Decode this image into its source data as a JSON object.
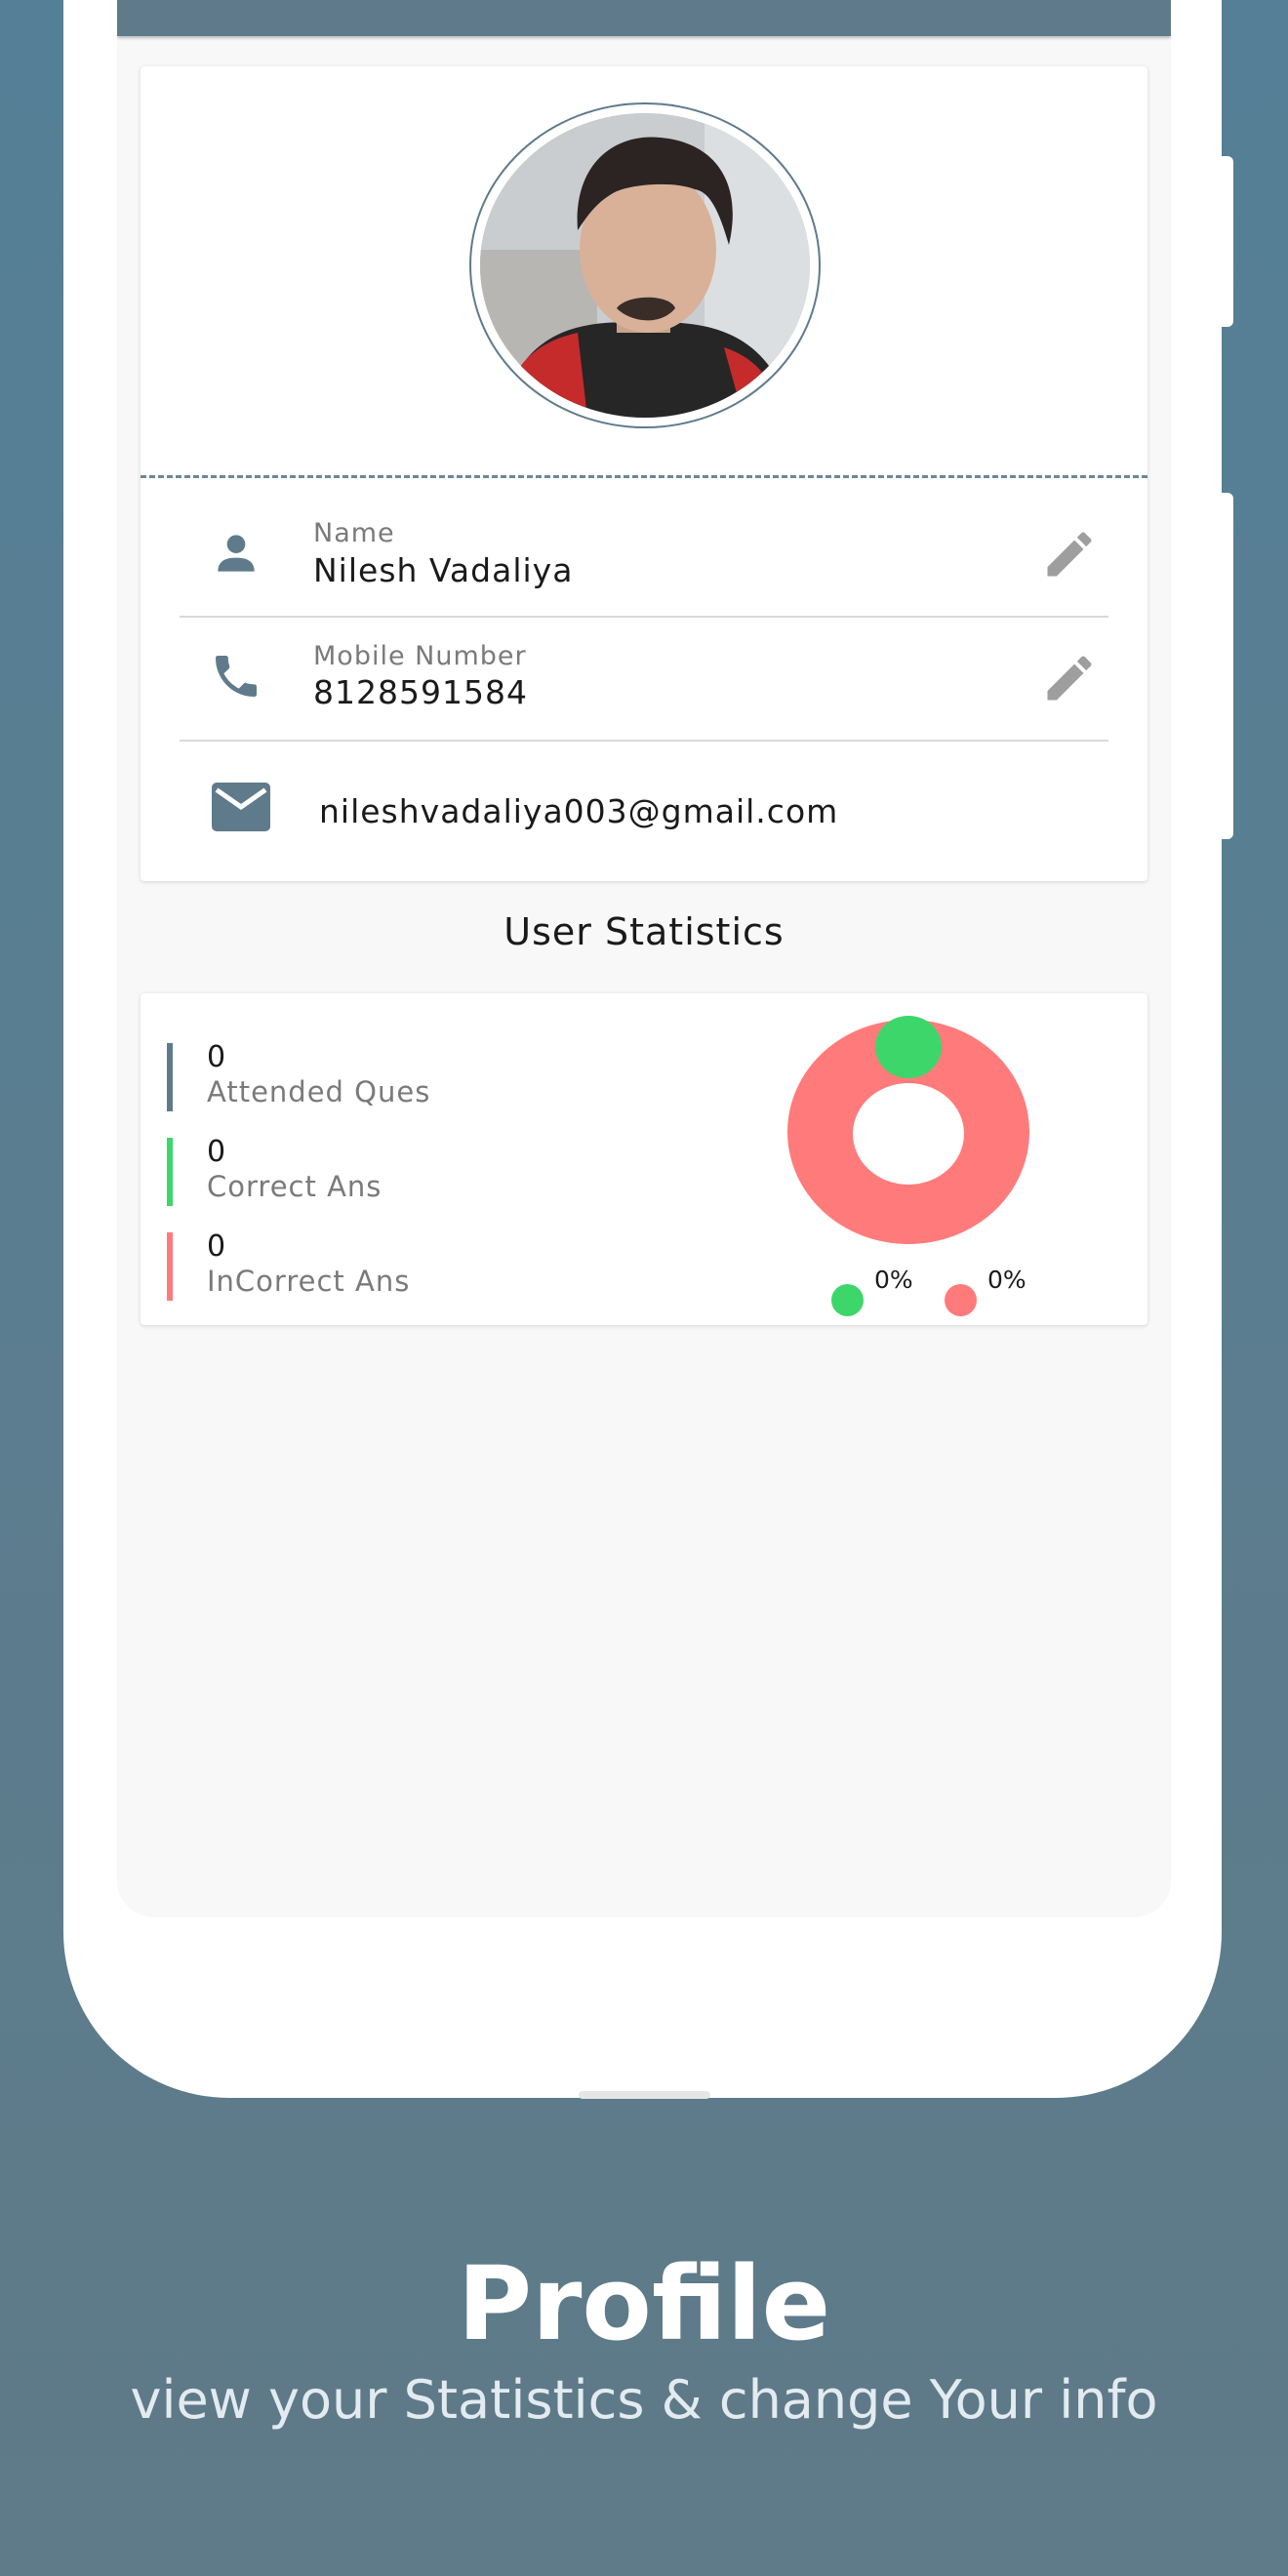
{
  "colors": {
    "accent": "#5f7b8b",
    "correct": "#3dd66a",
    "incorrect": "#ff7b7b",
    "attended": "#5f7b8b"
  },
  "profile": {
    "name_label": "Name",
    "name_value": "Nilesh Vadaliya",
    "mobile_label": "Mobile Number",
    "mobile_value": "8128591584",
    "email_value": "nileshvadaliya003@gmail.com",
    "icons": [
      "person-icon",
      "phone-icon",
      "mail-icon",
      "edit-icon"
    ]
  },
  "stats": {
    "title": "User Statistics",
    "items": [
      {
        "value": "0",
        "label": "Attended Ques"
      },
      {
        "value": "0",
        "label": "Correct Ans"
      },
      {
        "value": "0",
        "label": "InCorrect Ans"
      }
    ],
    "legend": [
      {
        "text": "0%"
      },
      {
        "text": "0%"
      }
    ]
  },
  "footer": {
    "title": "Profile",
    "subtitle": "view your Statistics & change Your info"
  }
}
